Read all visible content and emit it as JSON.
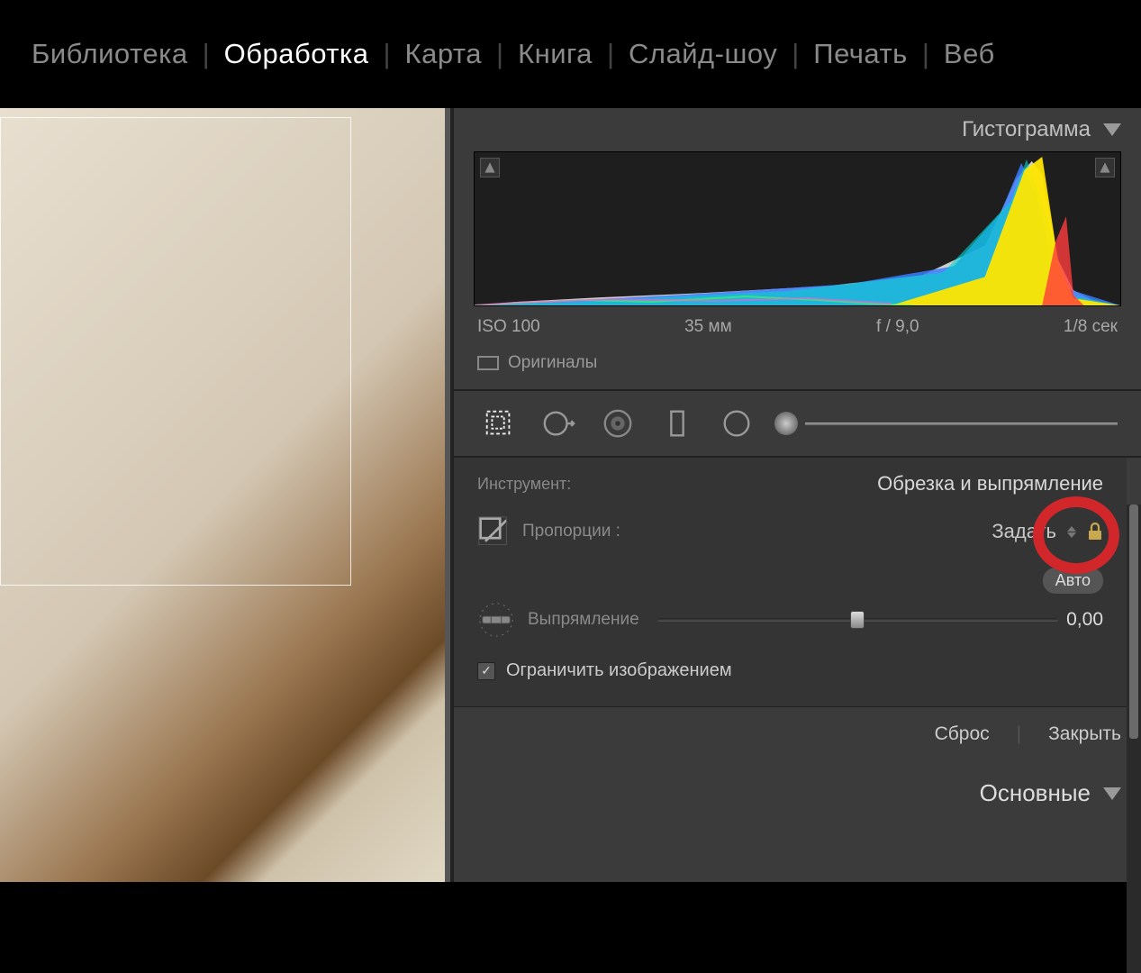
{
  "modules": {
    "items": [
      "Библиотека",
      "Обработка",
      "Карта",
      "Книга",
      "Слайд-шоу",
      "Печать",
      "Веб"
    ],
    "active_index": 1
  },
  "panel_histogram": {
    "title": "Гистограмма",
    "exif": {
      "iso": "ISO 100",
      "focal": "35 мм",
      "aperture": "f / 9,0",
      "shutter": "1/8 сек"
    },
    "originals_label": "Оригиналы"
  },
  "tool_section": {
    "label": "Инструмент:",
    "name": "Обрезка и выпрямление"
  },
  "crop": {
    "aspect_label": "Пропорции :",
    "aspect_value": "Задать",
    "straighten_label": "Выпрямление",
    "straighten_value": "0,00",
    "auto_label": "Авто",
    "constrain_label": "Ограничить изображением",
    "constrain_checked": true
  },
  "actions": {
    "reset": "Сброс",
    "close": "Закрыть"
  },
  "panel_basic": {
    "title": "Основные"
  }
}
